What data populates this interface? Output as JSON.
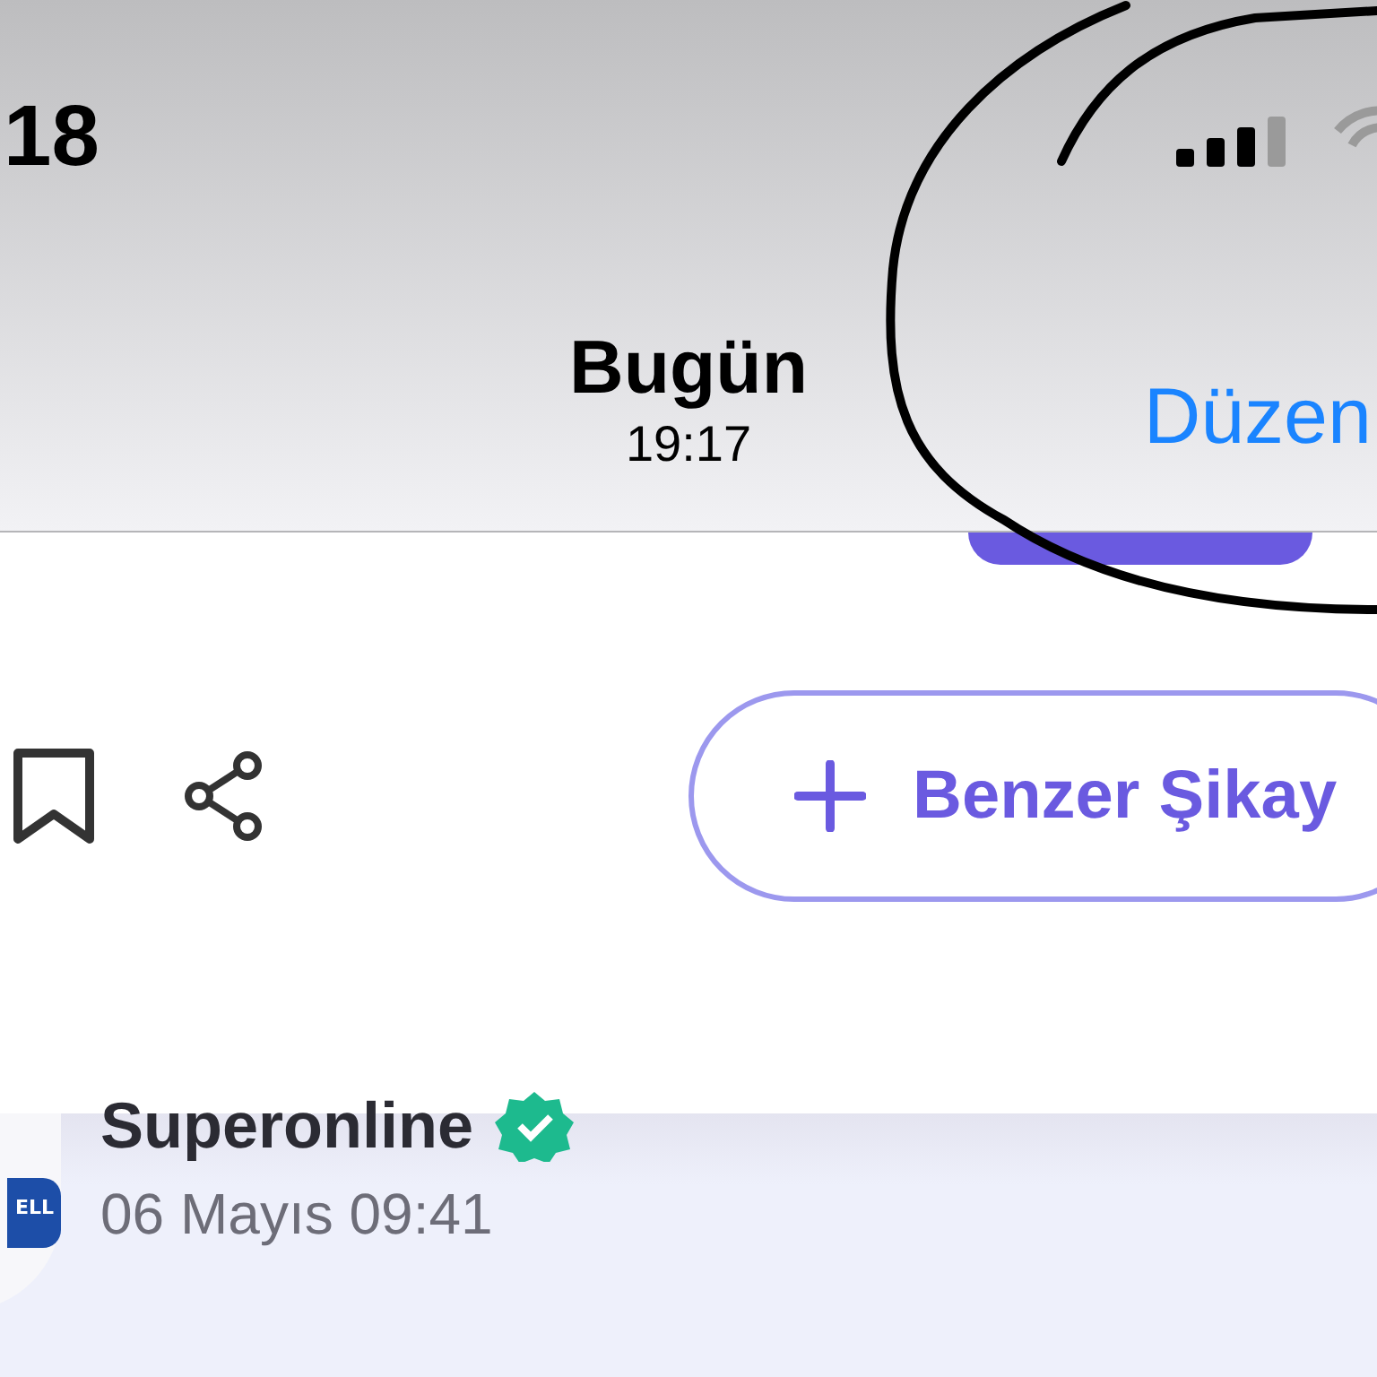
{
  "status_bar": {
    "time": "18"
  },
  "nav_bar": {
    "title": "Bugün",
    "subtitle": "19:17",
    "action": "Düzen"
  },
  "actions": {
    "similar_button": "Benzer Şikay"
  },
  "company": {
    "name": "Superonline",
    "verified": true,
    "logo_text": "ELL",
    "date": "06 Mayıs 09:41"
  }
}
